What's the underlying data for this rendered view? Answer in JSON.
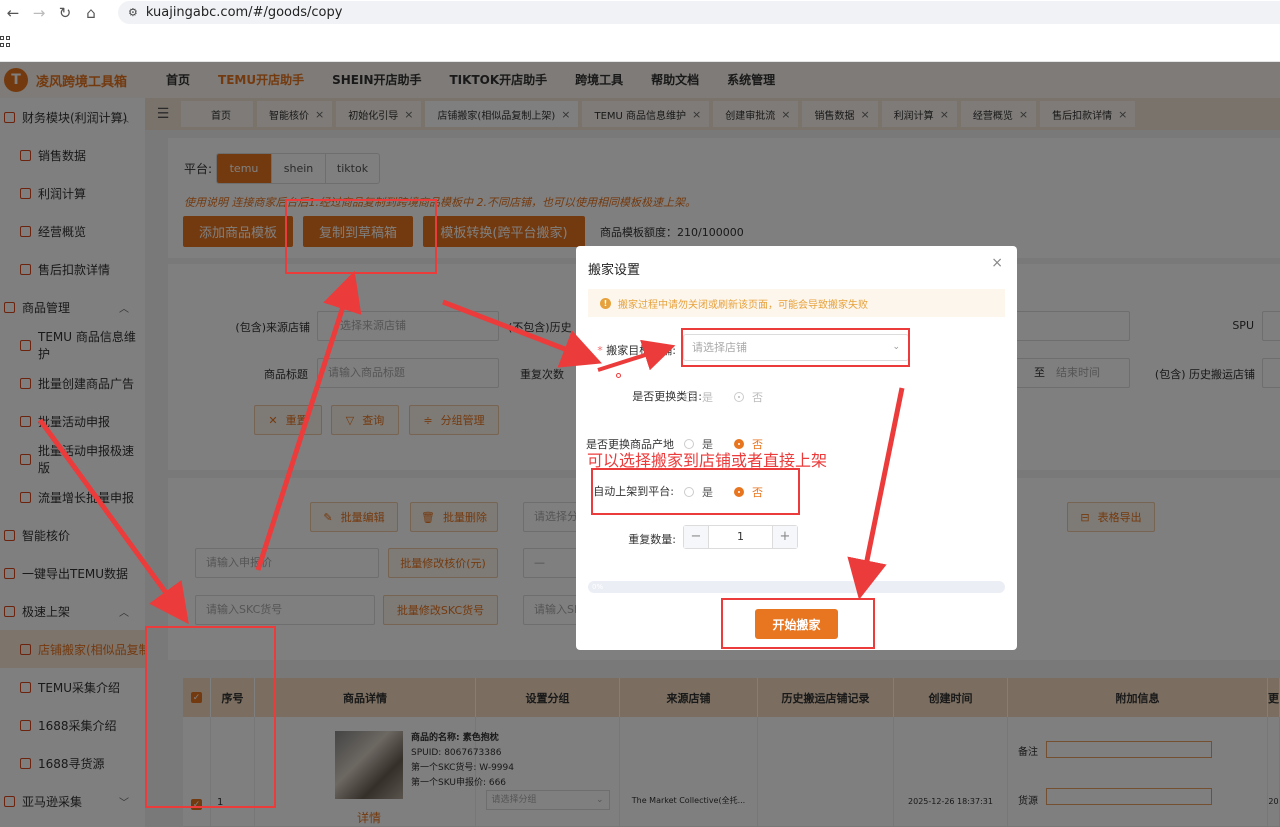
{
  "browser": {
    "url": "kuajingabc.com/#/goods/copy"
  },
  "app": {
    "logo_letter": "T",
    "logo_text": "凌风跨境工具箱",
    "top_menu": [
      "首页",
      "TEMU开店助手",
      "SHEIN开店助手",
      "TIKTOK开店助手",
      "跨境工具",
      "帮助文档",
      "系统管理"
    ]
  },
  "sidebar": {
    "items": [
      {
        "label": "财务模块(利润计算)",
        "type": "group"
      },
      {
        "label": "销售数据",
        "type": "sub"
      },
      {
        "label": "利润计算",
        "type": "sub"
      },
      {
        "label": "经营概览",
        "type": "sub"
      },
      {
        "label": "售后扣款详情",
        "type": "sub"
      },
      {
        "label": "商品管理",
        "type": "group"
      },
      {
        "label": "TEMU 商品信息维护",
        "type": "sub"
      },
      {
        "label": "批量创建商品广告",
        "type": "sub"
      },
      {
        "label": "批量活动申报",
        "type": "sub"
      },
      {
        "label": "批量活动申报极速版",
        "type": "sub"
      },
      {
        "label": "流量增长批量申报",
        "type": "sub"
      },
      {
        "label": "智能核价",
        "type": "group"
      },
      {
        "label": "一键导出TEMU数据",
        "type": "group"
      },
      {
        "label": "极速上架",
        "type": "group"
      },
      {
        "label": "店铺搬家(相似品复制上架)",
        "type": "sub"
      },
      {
        "label": "TEMU采集介绍",
        "type": "sub"
      },
      {
        "label": "1688采集介绍",
        "type": "sub"
      },
      {
        "label": "1688寻货源",
        "type": "sub"
      },
      {
        "label": "亚马逊采集",
        "type": "group"
      }
    ]
  },
  "tabs": [
    "首页",
    "智能核价",
    "初始化引导",
    "店铺搬家(相似品复制上架)",
    "TEMU 商品信息维护",
    "创建审批流",
    "销售数据",
    "利润计算",
    "经营概览",
    "售后扣款详情"
  ],
  "page": {
    "platform_label": "平台:",
    "platforms": [
      "temu",
      "shein",
      "tiktok"
    ],
    "hint": "使用说明 连接商家后台后1.经过商品复制到跨境商品模板中 2.不同店铺，也可以使用相同模板极速上架。",
    "btn_add_template": "添加商品模板",
    "btn_copy_draft": "复制到草稿箱",
    "btn_convert": "模板转换(跨平台搬家)",
    "quota": "商品模板额度：210/100000",
    "filters": {
      "source_shop_label": "(包含)来源店铺",
      "source_shop_placeholder": "选择来源店铺",
      "exclude_history_label": "(不包含)历史",
      "spu_label": "SPU",
      "title_label": "商品标题",
      "title_placeholder": "请输入商品标题",
      "repeat_label": "重复次数",
      "to_label": "至",
      "end_time_placeholder": "结束时间",
      "history_shop_label": "(包含) 历史搬运店铺"
    },
    "btn_reset": "重置",
    "btn_query": "查询",
    "btn_group": "分组管理",
    "btn_batch_edit": "批量编辑",
    "btn_batch_delete": "批量删除",
    "select_placeholder": "请选择分",
    "btn_export": "表格导出",
    "price_input_placeholder": "请输入申报价",
    "btn_batch_price": "批量修改核价(元)",
    "skc_input_placeholder": "请输入SKC货号",
    "btn_batch_skc": "批量修改SKC货号",
    "skc_input2_placeholder": "请输入SK"
  },
  "table": {
    "headers": [
      "序号",
      "商品详情",
      "设置分组",
      "来源店铺",
      "历史搬运店铺记录",
      "创建时间",
      "附加信息",
      "更"
    ],
    "row": {
      "index": "1",
      "name": "商品的名称: 素色抱枕",
      "spuid": "SPUID: 8067673386",
      "skc": "第一个SKC货号: W-9994",
      "sku_price": "第一个SKU申报价:   666",
      "detail_link": "详情",
      "group_placeholder": "请选择分组",
      "source_shop": "The Market Collective(全托...",
      "created": "2025-12-26 18:37:31",
      "note_label": "备注",
      "source_label": "货源",
      "extra": "20"
    }
  },
  "modal": {
    "title": "搬家设置",
    "alert": "搬家过程中请勿关闭或刷新该页面，可能会导致搬家失败",
    "target_label": "搬家目标店铺:",
    "target_placeholder": "请选择店铺",
    "change_category_label": "是否更换类目:",
    "change_origin_label": "是否更换商品产地",
    "auto_list_label": "自动上架到平台:",
    "yes": "是",
    "no": "否",
    "repeat_label": "重复数量:",
    "repeat_value": "1",
    "progress": "0%",
    "start_button": "开始搬家"
  },
  "annotation": {
    "text": "可以选择搬家到店铺或者直接上架"
  },
  "colors": {
    "accent": "#e8751f",
    "annotation": "#ec3b3b"
  }
}
